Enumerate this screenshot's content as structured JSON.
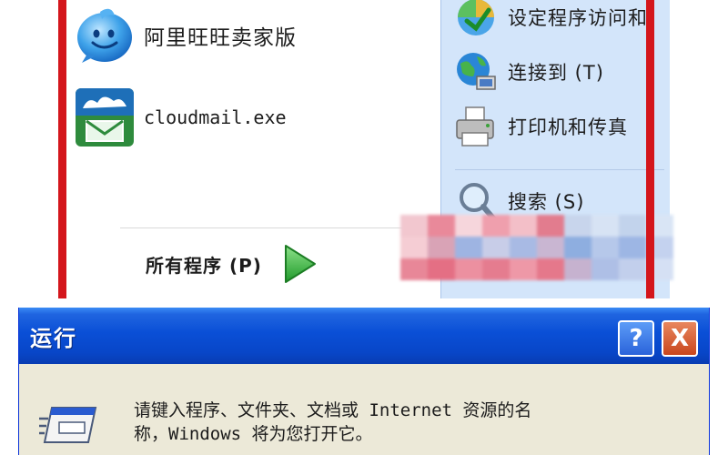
{
  "start_menu": {
    "programs": [
      {
        "label": "阿里旺旺卖家版",
        "icon": "aliwangwang-icon"
      },
      {
        "label": "cloudmail.exe",
        "icon": "cloudmail-icon"
      }
    ],
    "all_programs_label": "所有程序 (P)",
    "right_items": [
      {
        "label": "设定程序访问和",
        "icon": "program-access-icon"
      },
      {
        "label": "连接到 (T)",
        "icon": "connect-globe-icon"
      },
      {
        "label": "打印机和传真",
        "icon": "printer-icon"
      },
      {
        "label": "搜索 (S)",
        "icon": "search-icon"
      }
    ]
  },
  "run_dialog": {
    "title": "运行",
    "help_label": "?",
    "close_label": "X",
    "description_line1": "请键入程序、文件夹、文档或 Internet 资源的名",
    "description_line2": "称，Windows 将为您打开它。",
    "icon": "run-icon"
  },
  "colors": {
    "highlight_red": "#d4161c",
    "title_blue": "#0a4fd6",
    "right_pane": "#d3e5fa",
    "dialog_body": "#ece9d8"
  }
}
